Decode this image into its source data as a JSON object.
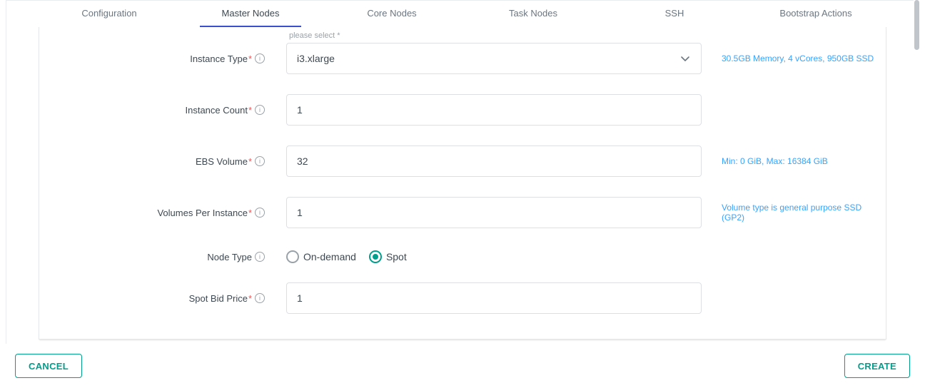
{
  "tabs": {
    "items": [
      "Configuration",
      "Master Nodes",
      "Core Nodes",
      "Task Nodes",
      "SSH",
      "Bootstrap Actions"
    ],
    "activeIndex": 1
  },
  "form": {
    "instanceType": {
      "label": "Instance Type",
      "floating": "please select *",
      "value": "i3.xlarge",
      "hint": "30.5GB Memory, 4 vCores, 950GB SSD"
    },
    "instanceCount": {
      "label": "Instance Count",
      "value": "1"
    },
    "ebsVolume": {
      "label": "EBS Volume",
      "value": "32",
      "hint": "Min: 0 GiB, Max: 16384 GiB"
    },
    "volumesPerInstance": {
      "label": "Volumes Per Instance",
      "value": "1",
      "hint": "Volume type is general purpose SSD (GP2)"
    },
    "nodeType": {
      "label": "Node Type",
      "options": [
        "On-demand",
        "Spot"
      ],
      "selected": "Spot"
    },
    "spotBidPrice": {
      "label": "Spot Bid Price",
      "value": "1"
    }
  },
  "footer": {
    "cancel": "CANCEL",
    "create": "CREATE"
  },
  "icons": {
    "info": "i"
  }
}
